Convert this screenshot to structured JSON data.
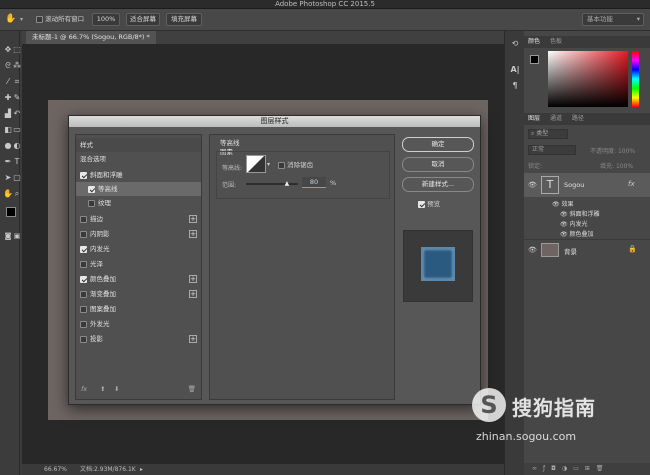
{
  "app_title": "Adobe Photoshop CC 2015.5",
  "options_bar": {
    "scroll_all_label": "滚动所有窗口",
    "zoom_value": "100%",
    "fit_screen": "适合屏幕",
    "fill_screen": "填充屏幕",
    "workspace": "基本功能"
  },
  "document_tab": "未标题-1 @ 66.7% (Sogou, RGB/8*) *",
  "status": {
    "zoom": "66.67%",
    "doc_size": "文档:2.93M/876.1K"
  },
  "dialog": {
    "title": "图层样式",
    "styles_header": "样式",
    "blend_options": "混合选项",
    "items": [
      {
        "label": "斜面和浮雕",
        "checked": true,
        "plus": false
      },
      {
        "label": "等高线",
        "checked": true,
        "plus": false
      },
      {
        "label": "纹理",
        "checked": false,
        "plus": false
      },
      {
        "label": "描边",
        "checked": false,
        "plus": true
      },
      {
        "label": "内阴影",
        "checked": false,
        "plus": true
      },
      {
        "label": "内发光",
        "checked": true,
        "plus": false
      },
      {
        "label": "光泽",
        "checked": false,
        "plus": false
      },
      {
        "label": "颜色叠加",
        "checked": true,
        "plus": true
      },
      {
        "label": "渐变叠加",
        "checked": false,
        "plus": true
      },
      {
        "label": "图案叠加",
        "checked": false,
        "plus": false
      },
      {
        "label": "外发光",
        "checked": false,
        "plus": false
      },
      {
        "label": "投影",
        "checked": false,
        "plus": true
      }
    ],
    "fx_label": "fx",
    "contour_section": "等高线",
    "image_section": "图素",
    "contour_label": "等高线:",
    "antialias_label": "消除锯齿",
    "range_label": "范围:",
    "range_value": "80",
    "range_unit": "%",
    "range_fraction": 0.8,
    "ok": "确定",
    "cancel": "取消",
    "new_style": "新建样式...",
    "preview_label": "预览",
    "preview_color": "#2b5a80"
  },
  "color_panel": {
    "tab1": "颜色",
    "tab2": "色板"
  },
  "layers_panel": {
    "tabs": [
      "图层",
      "通道",
      "路径"
    ],
    "kind": "类型",
    "blend_mode": "正常",
    "opacity_label": "不透明度:",
    "opacity_value": "100%",
    "lock_label": "锁定:",
    "fill_label": "填充:",
    "fill_value": "100%",
    "layers": [
      {
        "name": "Sogou",
        "type": "text",
        "fx": "fx"
      },
      {
        "name": "效果",
        "type": "effects-header"
      },
      {
        "name": "斜面和浮雕",
        "type": "effect"
      },
      {
        "name": "内发光",
        "type": "effect"
      },
      {
        "name": "颜色叠加",
        "type": "effect"
      },
      {
        "name": "背景",
        "type": "background"
      }
    ]
  },
  "watermark": {
    "brand": "搜狗指南",
    "url": "zhinan.sogou.com"
  }
}
